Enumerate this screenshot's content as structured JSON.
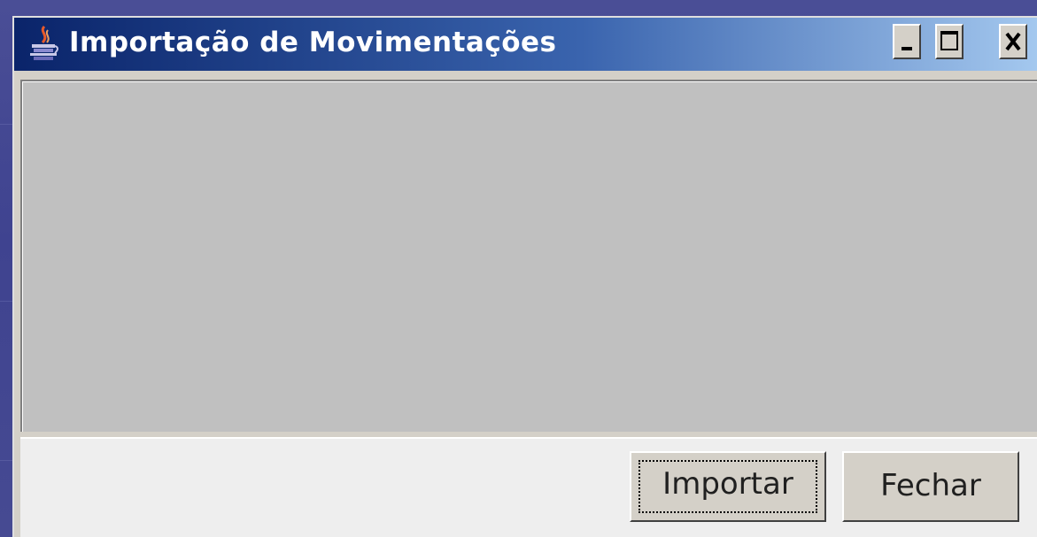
{
  "window": {
    "title": "Importação de Movimentações",
    "title_icon": "java-cup-icon",
    "controls": [
      "minimize-icon",
      "maximize-icon",
      "close-icon"
    ]
  },
  "content": {
    "panel": "empty"
  },
  "buttons": {
    "import_label": "Importar",
    "close_label": "Fechar"
  },
  "colors": {
    "titlebar_start": "#0a246a",
    "titlebar_end": "#a6caf0",
    "window_face": "#d4d0c8",
    "content_panel": "#c0c0c0",
    "button_bar": "#eeeeee",
    "desktop": "#464a92"
  }
}
